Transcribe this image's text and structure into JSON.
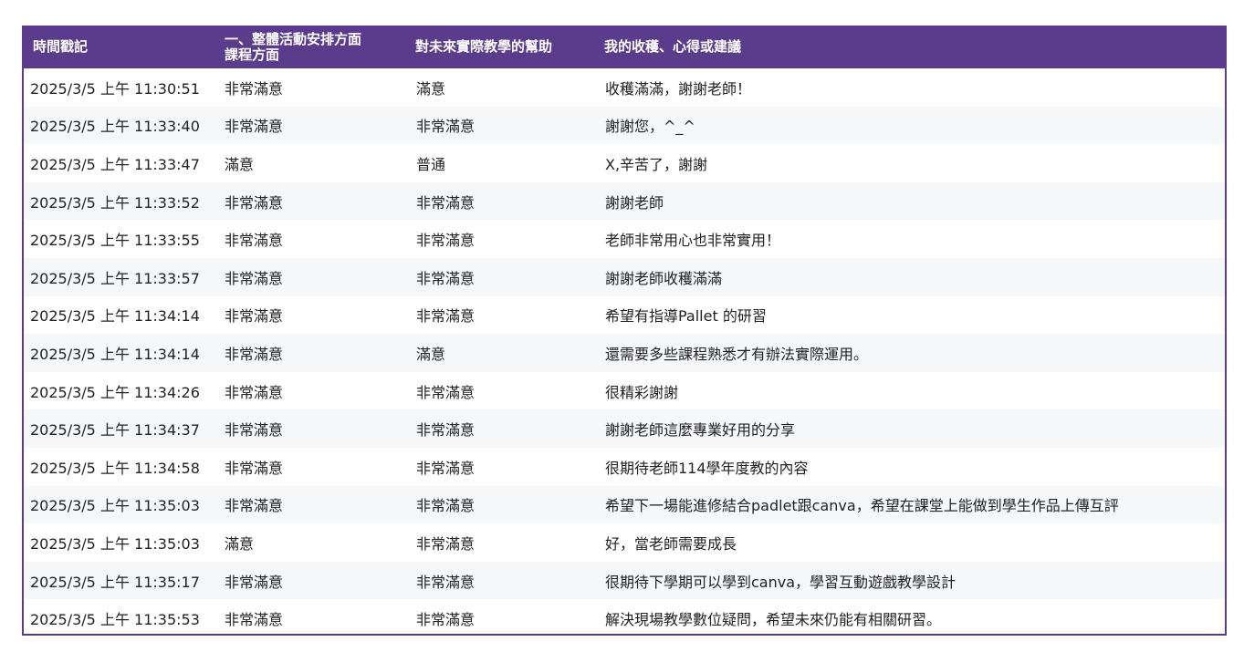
{
  "table": {
    "headers": {
      "time": "時間戳記",
      "activity_line1": "一、整體活動安排方面",
      "activity_line2": "課程方面",
      "help": "對未來實際教學的幫助",
      "feedback": "我的收穫、心得或建議"
    },
    "rows": [
      {
        "time": "2025/3/5 上午 11:30:51",
        "activity": "非常滿意",
        "help": "滿意",
        "feedback": "收穫滿滿，謝謝老師！"
      },
      {
        "time": "2025/3/5 上午 11:33:40",
        "activity": "非常滿意",
        "help": "非常滿意",
        "feedback": "謝謝您，^_^"
      },
      {
        "time": "2025/3/5 上午 11:33:47",
        "activity": "滿意",
        "help": "普通",
        "feedback": "X,辛苦了，謝謝"
      },
      {
        "time": "2025/3/5 上午 11:33:52",
        "activity": "非常滿意",
        "help": "非常滿意",
        "feedback": "謝謝老師"
      },
      {
        "time": "2025/3/5 上午 11:33:55",
        "activity": "非常滿意",
        "help": "非常滿意",
        "feedback": "老師非常用心也非常實用！"
      },
      {
        "time": "2025/3/5 上午 11:33:57",
        "activity": "非常滿意",
        "help": "非常滿意",
        "feedback": "謝謝老師收穫滿滿"
      },
      {
        "time": "2025/3/5 上午 11:34:14",
        "activity": "非常滿意",
        "help": "非常滿意",
        "feedback": "希望有指導Pallet 的研習"
      },
      {
        "time": "2025/3/5 上午 11:34:14",
        "activity": "非常滿意",
        "help": "滿意",
        "feedback": "還需要多些課程熟悉才有辦法實際運用。"
      },
      {
        "time": "2025/3/5 上午 11:34:26",
        "activity": "非常滿意",
        "help": "非常滿意",
        "feedback": "很精彩謝謝"
      },
      {
        "time": "2025/3/5 上午 11:34:37",
        "activity": "非常滿意",
        "help": "非常滿意",
        "feedback": "謝謝老師這麼專業好用的分享"
      },
      {
        "time": "2025/3/5 上午 11:34:58",
        "activity": "非常滿意",
        "help": "非常滿意",
        "feedback": "很期待老師114學年度教的內容"
      },
      {
        "time": "2025/3/5 上午 11:35:03",
        "activity": "非常滿意",
        "help": "非常滿意",
        "feedback": "希望下一場能進修結合padlet跟canva，希望在課堂上能做到學生作品上傳互評"
      },
      {
        "time": "2025/3/5 上午 11:35:03",
        "activity": "滿意",
        "help": "非常滿意",
        "feedback": "好，當老師需要成長"
      },
      {
        "time": "2025/3/5 上午 11:35:17",
        "activity": "非常滿意",
        "help": "非常滿意",
        "feedback": "很期待下學期可以學到canva，學習互動遊戲教學設計"
      },
      {
        "time": "2025/3/5 上午 11:35:53",
        "activity": "非常滿意",
        "help": "非常滿意",
        "feedback": "解決現場教學數位疑問，希望未來仍能有相關研習。"
      }
    ]
  },
  "colors": {
    "header_bg": "#5b3c8c",
    "header_text": "#ffffff",
    "row_alt_bg": "#f6f7f9"
  }
}
